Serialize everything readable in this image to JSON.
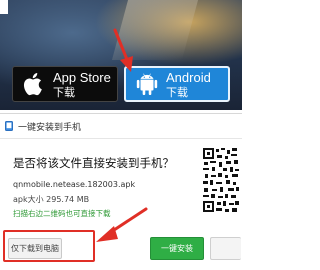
{
  "banner": {
    "apple": {
      "name": "App Store",
      "sub": "下载"
    },
    "android": {
      "name": "Android",
      "sub": "下载"
    }
  },
  "dialog": {
    "title": "一键安装到手机",
    "question": "是否将该文件直接安装到手机？",
    "filename": "qnmobile.netease.182003.apk",
    "filesize": "apk大小 295.74 MB",
    "hint": "扫描右边二维码也可直接下载",
    "download_pc_label": "仅下载到电脑",
    "install_label": "一键安装"
  },
  "colors": {
    "android_button": "#1f86d8",
    "install_button": "#2fae45",
    "annotation_red": "#e02f26",
    "hint_green": "#2f9a36"
  },
  "icons": [
    "apple-icon",
    "android-icon",
    "phone-icon",
    "qr-code-icon",
    "red-arrow-icon"
  ]
}
